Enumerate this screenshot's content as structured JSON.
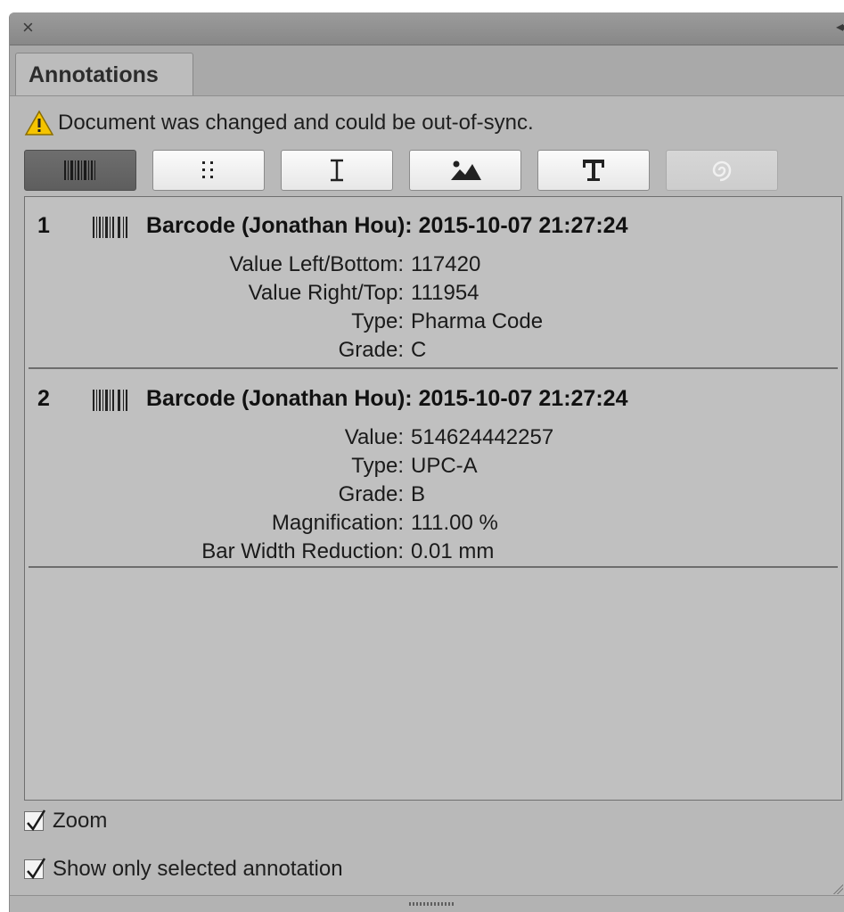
{
  "window": {
    "close_icon": "close-icon",
    "collapse_icon": "collapse-double-arrow-icon"
  },
  "tabs": [
    {
      "label": "Annotations"
    }
  ],
  "warning": {
    "icon": "warning-triangle-icon",
    "text": "Document was changed and could be out-of-sync."
  },
  "toolbar": {
    "buttons": [
      {
        "icon": "barcode-icon",
        "state": "active"
      },
      {
        "icon": "dots-grid-icon",
        "state": "normal"
      },
      {
        "icon": "text-cursor-icon",
        "state": "normal"
      },
      {
        "icon": "image-icon",
        "state": "normal"
      },
      {
        "icon": "type-icon",
        "state": "normal"
      },
      {
        "icon": "spiral-icon",
        "state": "disabled"
      }
    ]
  },
  "annotations": [
    {
      "number": "1",
      "icon": "barcode-icon",
      "title": "Barcode (Jonathan Hou): 2015-10-07 21:27:24",
      "properties": [
        {
          "key": "Value Left/Bottom:",
          "value": "117420"
        },
        {
          "key": "Value Right/Top:",
          "value": "111954"
        },
        {
          "key": "Type:",
          "value": "Pharma Code"
        },
        {
          "key": "Grade:",
          "value": "C"
        }
      ]
    },
    {
      "number": "2",
      "icon": "barcode-icon",
      "title": "Barcode (Jonathan Hou): 2015-10-07 21:27:24",
      "properties": [
        {
          "key": "Value:",
          "value": "514624442257"
        },
        {
          "key": "Type:",
          "value": "UPC-A"
        },
        {
          "key": "Grade:",
          "value": "B"
        },
        {
          "key": "Magnification:",
          "value": "111.00 %"
        },
        {
          "key": "Bar Width Reduction:",
          "value": "0.01 mm"
        }
      ]
    }
  ],
  "options": {
    "zoom": {
      "label": "Zoom",
      "checked": true
    },
    "show_only_selected": {
      "label": "Show only selected annotation",
      "checked": true
    }
  },
  "colors": {
    "panel_bg": "#b9b9b9",
    "warning_yellow": "#f5c400",
    "active_button": "#666666"
  }
}
